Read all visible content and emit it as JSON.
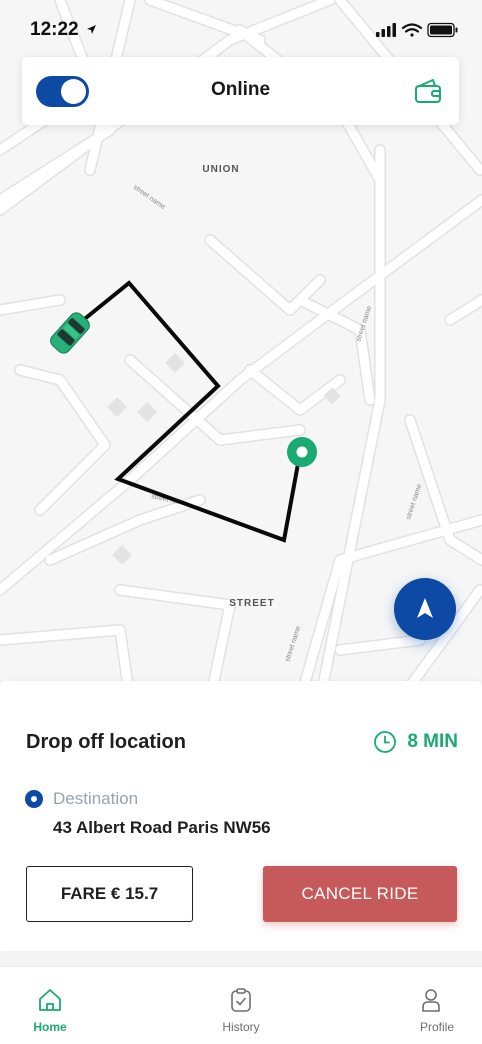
{
  "status_bar": {
    "time": "12:22"
  },
  "header": {
    "online_label": "Online",
    "online_toggle_on": true
  },
  "map": {
    "area_labels": [
      "UNION",
      "STREET"
    ],
    "street_labels": [
      "street name",
      "street name",
      "street name",
      "street name",
      "street name"
    ]
  },
  "ride": {
    "title": "Drop off location",
    "eta": "8 MIN",
    "destination_label": "Destination",
    "destination_address": "43 Albert Road Paris NW56",
    "fare_label": "FARE € 15.7",
    "cancel_label": "CANCEL RIDE"
  },
  "tabs": [
    {
      "label": "Home",
      "icon": "home-icon",
      "active": true
    },
    {
      "label": "History",
      "icon": "clipboard-icon",
      "active": false
    },
    {
      "label": "Profile",
      "icon": "user-icon",
      "active": false
    }
  ],
  "colors": {
    "brand": "#0d4aa6",
    "accent": "#1aab72",
    "danger": "#c65a5a"
  }
}
